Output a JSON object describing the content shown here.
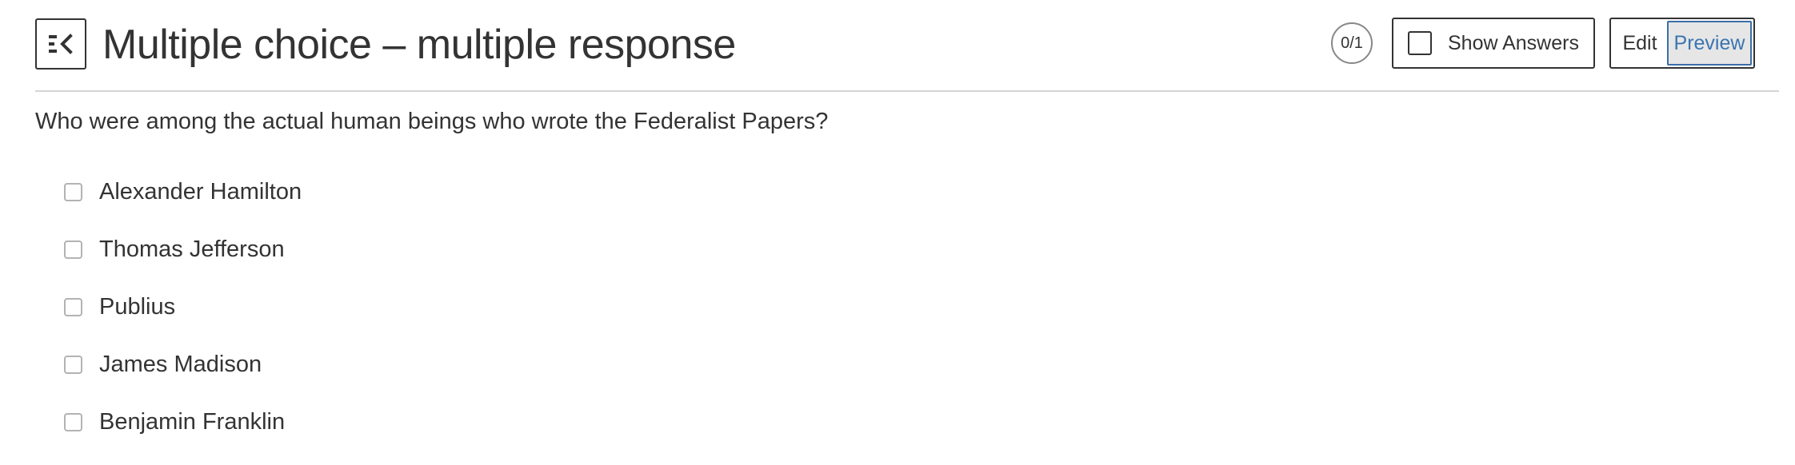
{
  "header": {
    "title": "Multiple choice – multiple response",
    "score": "0/1",
    "show_answers_label": "Show Answers",
    "modes": {
      "edit": "Edit",
      "preview": "Preview",
      "active": "preview"
    }
  },
  "icons": {
    "collapse": "collapse-sidebar-icon",
    "show_answers_checkbox": "checkbox-empty-icon",
    "option_checkbox": "checkbox-empty-icon"
  },
  "colors": {
    "accent": "#3b75b0",
    "text": "#333333",
    "divider": "#d4d4d4",
    "checkbox_border": "#b3b3b3"
  },
  "question": {
    "text": "Who were among the actual human beings who wrote the Federalist Papers?",
    "options": [
      {
        "label": "Alexander Hamilton",
        "checked": false
      },
      {
        "label": "Thomas Jefferson",
        "checked": false
      },
      {
        "label": "Publius",
        "checked": false
      },
      {
        "label": "James Madison",
        "checked": false
      },
      {
        "label": "Benjamin Franklin",
        "checked": false
      }
    ]
  }
}
